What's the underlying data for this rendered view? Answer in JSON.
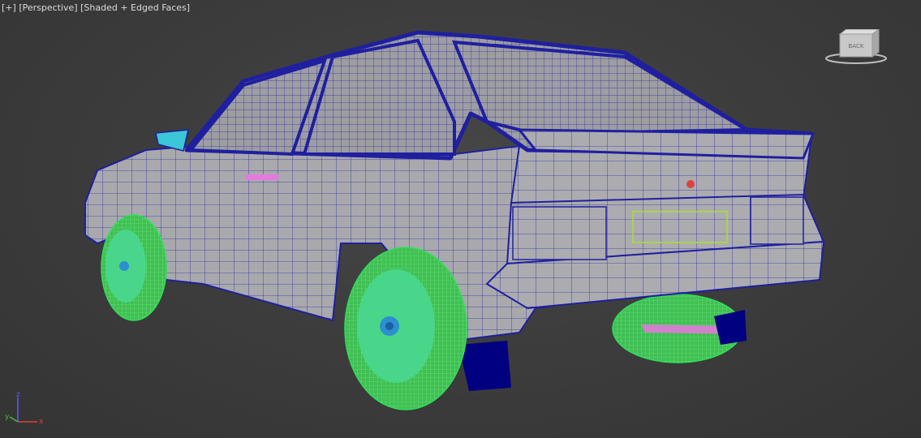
{
  "viewport": {
    "label_plus": "[+]",
    "label_view": "[Perspective]",
    "label_shading": "[Shaded + Edged Faces]"
  },
  "viewcube": {
    "face_label": "BACK",
    "icon": "viewcube-icon"
  },
  "axis_tripod": {
    "x": "x",
    "y": "y",
    "z": "z",
    "icon": "axis-tripod-icon"
  },
  "colors": {
    "background": "#3a3a3a",
    "body": "#a9a9ad",
    "wire_body": "#1f1fa0",
    "glass": "#9d9da2",
    "wheel": "#49d68a",
    "wheel_wire": "#2fe05a",
    "mudflap": "#000080",
    "plate_outline": "#a6e22a",
    "light_cyan": "#3cc7d8",
    "handle_pink": "#e47ae0",
    "axis_x": "#e04040",
    "axis_y": "#40c040",
    "axis_z": "#5060ff"
  }
}
